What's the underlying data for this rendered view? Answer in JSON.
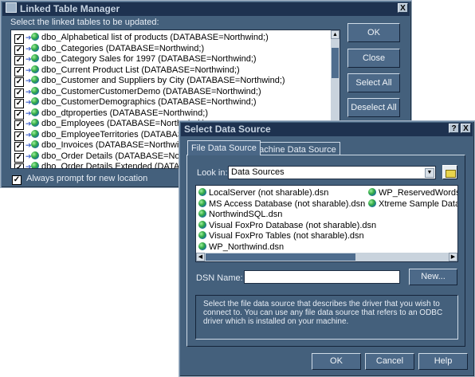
{
  "linked_manager": {
    "title": "Linked Table Manager",
    "close_glyph": "X",
    "instruction": "Select the linked tables to be updated:",
    "tables": [
      "dbo_Alphabetical list of products  (DATABASE=Northwind;)",
      "dbo_Categories  (DATABASE=Northwind;)",
      "dbo_Category Sales for 1997  (DATABASE=Northwind;)",
      "dbo_Current Product List  (DATABASE=Northwind;)",
      "dbo_Customer and Suppliers by City  (DATABASE=Northwind;)",
      "dbo_CustomerCustomerDemo  (DATABASE=Northwind;)",
      "dbo_CustomerDemographics  (DATABASE=Northwind;)",
      "dbo_dtproperties  (DATABASE=Northwind;)",
      "dbo_Employees  (DATABASE=Northwind;)",
      "dbo_EmployeeTerritories  (DATABASE=Northwind;)",
      "dbo_Invoices  (DATABASE=Northwind;)",
      "dbo_Order Details  (DATABASE=Northwind;)",
      "dbo_Order Details Extended  (DATABASE=Northwind;)"
    ],
    "buttons": {
      "ok": "OK",
      "close": "Close",
      "select_all": "Select All",
      "deselect_all": "Deselect All"
    },
    "always_prompt": "Always prompt for new location",
    "check_glyph": "✓"
  },
  "select_dsn": {
    "title": "Select Data Source",
    "help_glyph": "?",
    "close_glyph": "X",
    "tabs": [
      "File Data Source",
      "Machine Data Source"
    ],
    "look_in_label": "Look in:",
    "look_in_value": "Data Sources",
    "files_col1": [
      "LocalServer (not sharable).dsn",
      "MS Access Database (not sharable).dsn",
      "NorthwindSQL.dsn",
      "Visual FoxPro Database (not sharable).dsn",
      "Visual FoxPro Tables (not sharable).dsn",
      "WP_Northwind.dsn"
    ],
    "files_col2": [
      "WP_ReservedWordsTes",
      "Xtreme Sample Database"
    ],
    "dsn_name_label": "DSN Name:",
    "dsn_name_value": "",
    "new_button": "New...",
    "description": "Select the file data source that describes the driver that you wish to connect to. You can use any file data source that refers to an ODBC driver which is installed on your machine.",
    "buttons": {
      "ok": "OK",
      "cancel": "Cancel",
      "help": "Help"
    }
  },
  "colors": {
    "dialog_bg": "#44607c",
    "titlebar": "#1e3250",
    "list_bg": "#ffffff"
  }
}
